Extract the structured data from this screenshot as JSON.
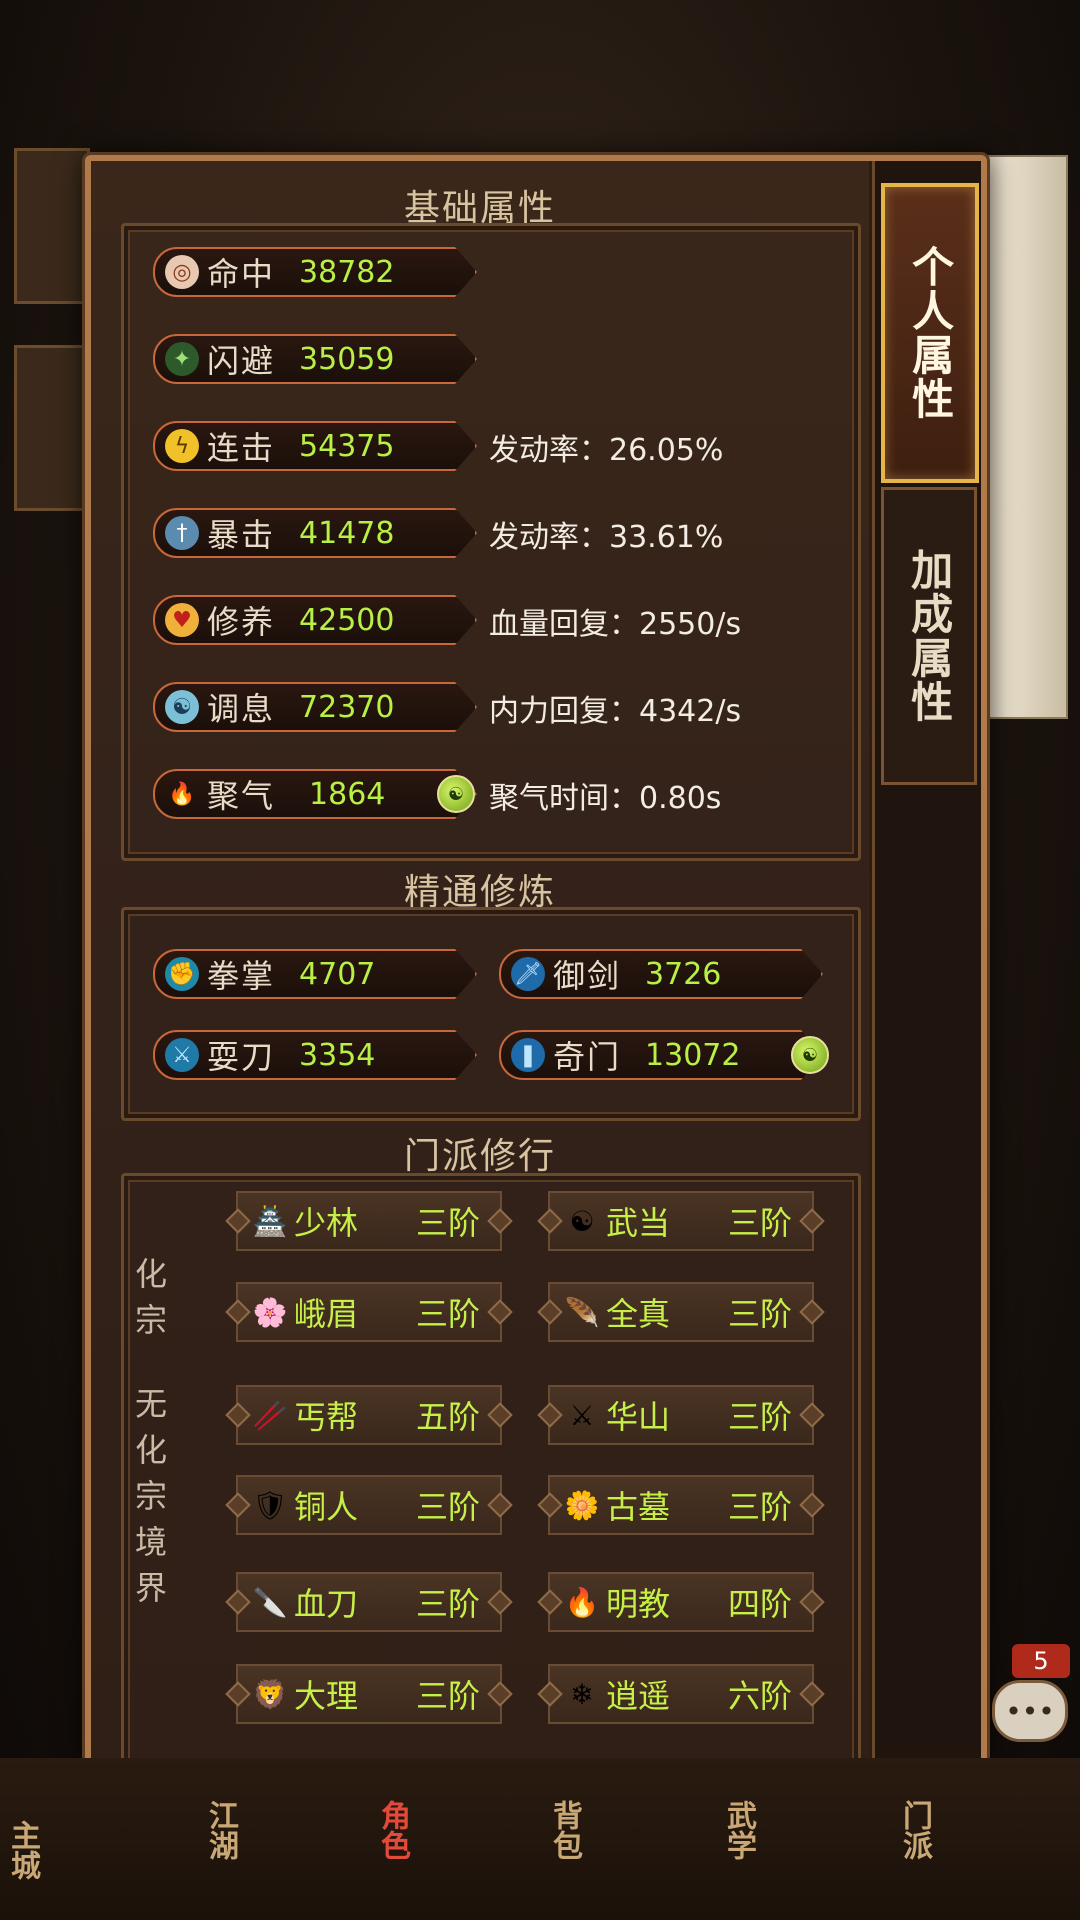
{
  "tabs": [
    {
      "label": "个人属性",
      "active": true
    },
    {
      "label": "加成属性",
      "active": false
    }
  ],
  "sections": {
    "basic_title": "基础属性",
    "mastery_title": "精通修炼",
    "sect_title": "门派修行"
  },
  "basic_stats": [
    {
      "name": "命中",
      "value": "38782",
      "extra": "",
      "icon": "target-icon"
    },
    {
      "name": "闪避",
      "value": "35059",
      "extra": "",
      "icon": "dodge-boot-icon"
    },
    {
      "name": "连击",
      "value": "54375",
      "extra": "发动率：26.05%",
      "icon": "lightning-icon"
    },
    {
      "name": "暴击",
      "value": "41478",
      "extra": "发动率：33.61%",
      "icon": "crit-sword-icon"
    },
    {
      "name": "修养",
      "value": "42500",
      "extra": "血量回复：2550/s",
      "icon": "heart-icon"
    },
    {
      "name": "调息",
      "value": "72370",
      "extra": "内力回复：4342/s",
      "icon": "breath-swirl-icon"
    },
    {
      "name": "聚气",
      "value": "1864",
      "extra": "聚气时间：0.80s",
      "icon": "flame-icon"
    }
  ],
  "mastery_stats": [
    {
      "name": "拳掌",
      "value": "4707",
      "icon": "fist-icon"
    },
    {
      "name": "御剑",
      "value": "3726",
      "icon": "sword-icon"
    },
    {
      "name": "耍刀",
      "value": "3354",
      "icon": "blade-icon"
    },
    {
      "name": "奇门",
      "value": "13072",
      "icon": "odd-weapon-icon"
    }
  ],
  "side_labels": {
    "top": "化宗",
    "bottom": "无化宗境界"
  },
  "sects": [
    {
      "name": "少林",
      "rank": "三阶",
      "icon": "shaolin-icon"
    },
    {
      "name": "武当",
      "rank": "三阶",
      "icon": "wudang-icon"
    },
    {
      "name": "峨眉",
      "rank": "三阶",
      "icon": "emei-icon"
    },
    {
      "name": "全真",
      "rank": "三阶",
      "icon": "quanzhen-icon"
    },
    {
      "name": "丐帮",
      "rank": "五阶",
      "icon": "gaibang-icon"
    },
    {
      "name": "华山",
      "rank": "三阶",
      "icon": "huashan-icon"
    },
    {
      "name": "铜人",
      "rank": "三阶",
      "icon": "tongren-icon"
    },
    {
      "name": "古墓",
      "rank": "三阶",
      "icon": "gumu-icon"
    },
    {
      "name": "血刀",
      "rank": "三阶",
      "icon": "xuedao-icon"
    },
    {
      "name": "明教",
      "rank": "四阶",
      "icon": "mingjiao-icon"
    },
    {
      "name": "大理",
      "rank": "三阶",
      "icon": "dali-icon"
    },
    {
      "name": "逍遥",
      "rank": "六阶",
      "icon": "xiaoyao-icon"
    }
  ],
  "chat": {
    "badge": "5"
  },
  "bottom_nav": [
    {
      "label": "主城",
      "active": false
    },
    {
      "label": "江湖",
      "active": false
    },
    {
      "label": "角色",
      "active": true
    },
    {
      "label": "背包",
      "active": false
    },
    {
      "label": "武学",
      "active": false
    },
    {
      "label": "门派",
      "active": false
    }
  ],
  "colors": {
    "value_green": "#b8f046",
    "active_tab_border": "#e6b54a",
    "pill_border": "#c8683a"
  }
}
